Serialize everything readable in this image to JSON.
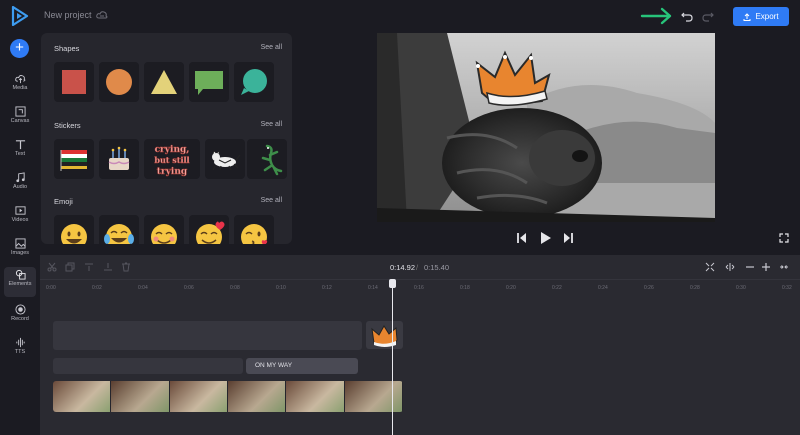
{
  "header": {
    "project_name": "New project",
    "export_label": "Export"
  },
  "nav": {
    "add_label": "+",
    "items": [
      {
        "label": "Media",
        "icon": "cloud-upload-icon"
      },
      {
        "label": "Canvas",
        "icon": "canvas-icon"
      },
      {
        "label": "Text",
        "icon": "text-icon"
      },
      {
        "label": "Audio",
        "icon": "music-note-icon"
      },
      {
        "label": "Videos",
        "icon": "video-icon"
      },
      {
        "label": "Images",
        "icon": "image-icon"
      },
      {
        "label": "Elements",
        "icon": "elements-icon"
      },
      {
        "label": "Record",
        "icon": "record-icon"
      },
      {
        "label": "TTS",
        "icon": "waveform-icon"
      }
    ],
    "active": "Elements"
  },
  "panel": {
    "sections": [
      {
        "title": "Shapes",
        "see_all": "See all"
      },
      {
        "title": "Stickers",
        "see_all": "See all"
      },
      {
        "title": "Emoji",
        "see_all": "See all"
      }
    ],
    "shapes": [
      "square",
      "circle",
      "triangle",
      "speech-bubble",
      "round-bubble"
    ],
    "shape_colors": {
      "square": "#c9524a",
      "circle": "#e08a4a",
      "triangle": "#e3d27a",
      "speech-bubble": "#6dae5a",
      "round-bubble": "#3bb39a"
    },
    "stickers": [
      {
        "name": "flag-sticker"
      },
      {
        "name": "cake-sticker"
      },
      {
        "name": "crying-text-sticker",
        "text": "crying, but still trying"
      },
      {
        "name": "cat-sticker"
      },
      {
        "name": "lizard-sticker"
      }
    ],
    "emoji": [
      "😀",
      "😂",
      "😊",
      "😊",
      "😘"
    ]
  },
  "playback": {
    "current_time": "0:14.92",
    "separator": "/",
    "total_time": "0:15.40"
  },
  "timeline": {
    "ruler": [
      "0:00",
      "0:02",
      "0:04",
      "0:06",
      "0:08",
      "0:10",
      "0:12",
      "0:14",
      "0:16",
      "0:18",
      "0:20",
      "0:22",
      "0:24",
      "0:26",
      "0:28",
      "0:30",
      "0:32",
      "0:34"
    ],
    "text_clip_label": "ON MY WAY"
  },
  "colors": {
    "accent": "#2f7bf5",
    "hint_arrow": "#27c47a",
    "crown": "#e8852f"
  }
}
